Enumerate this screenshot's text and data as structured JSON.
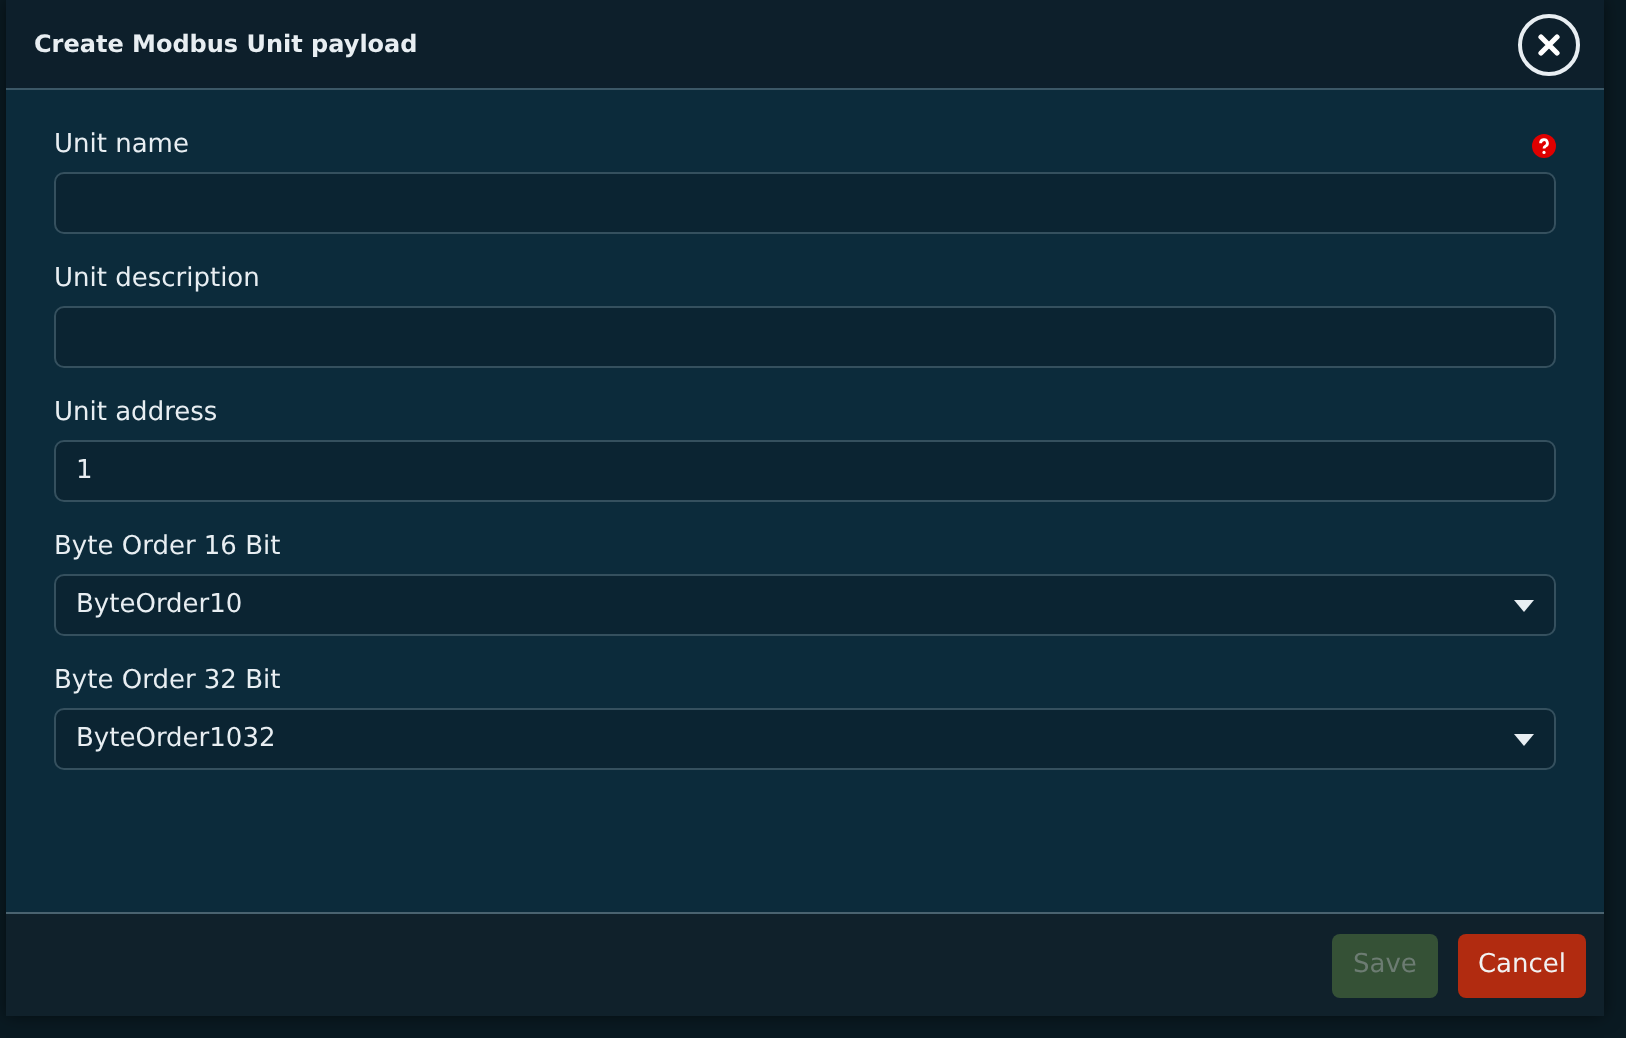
{
  "dialog": {
    "title": "Create Modbus Unit payload"
  },
  "fields": [
    {
      "kind": "text",
      "label": "Unit name",
      "help": true
    },
    {
      "kind": "text",
      "label": "Unit description",
      "help": false
    },
    {
      "kind": "text",
      "label": "Unit address",
      "value": "1",
      "help": false
    },
    {
      "kind": "select",
      "label": "Byte Order 16 Bit",
      "value": "ByteOrder10",
      "help": false
    },
    {
      "kind": "select",
      "label": "Byte Order 32 Bit",
      "value": "ByteOrder1032",
      "help": false
    }
  ],
  "buttons": [
    {
      "label": "Save",
      "kind": "save",
      "disabled": true
    },
    {
      "label": "Cancel",
      "kind": "cancel",
      "disabled": false
    }
  ]
}
